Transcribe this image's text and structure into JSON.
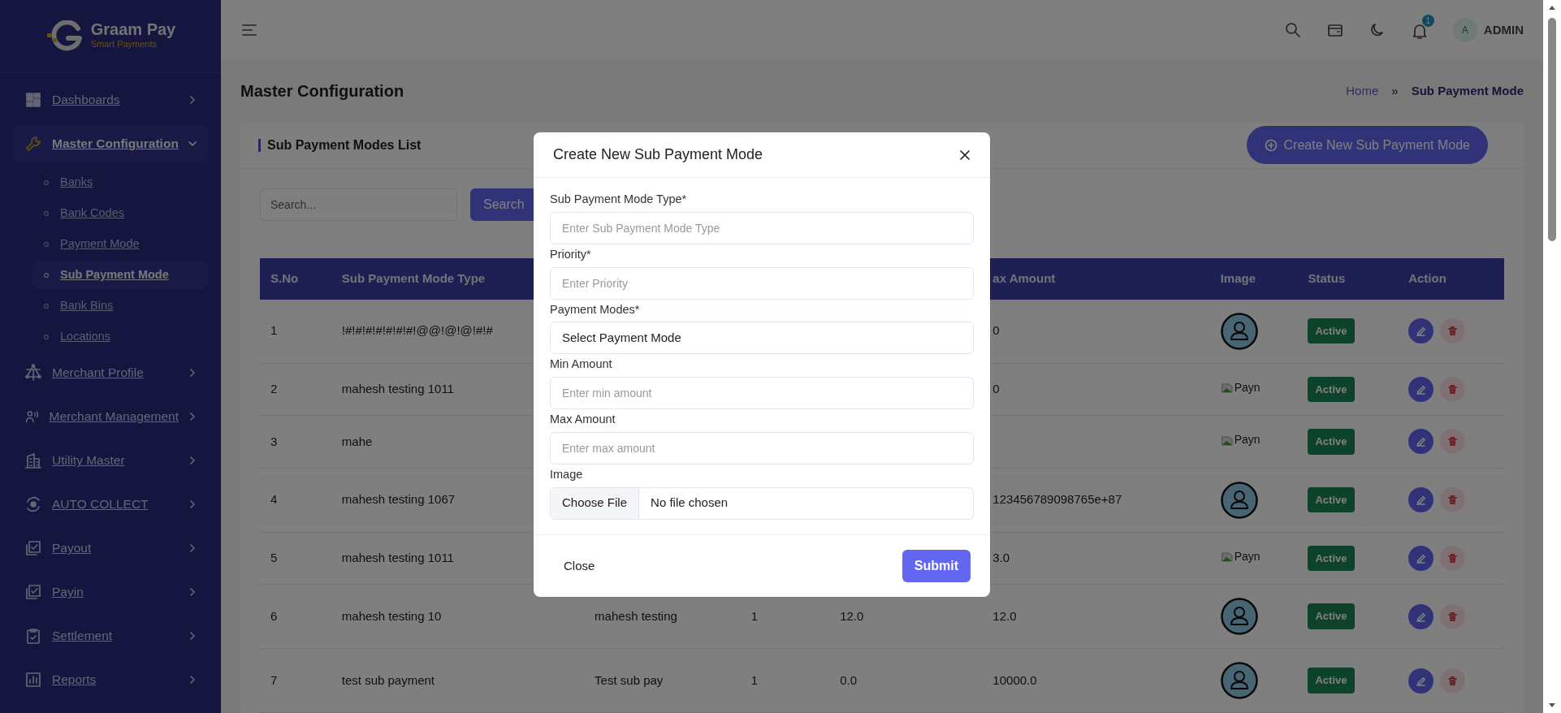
{
  "sidebar": {
    "logo": {
      "name": "Graam Pay",
      "tagline": "Smart Payments"
    },
    "items": [
      {
        "label": "Dashboards",
        "expanded": false,
        "selected": false
      },
      {
        "label": "Master Configuration",
        "expanded": true,
        "selected": true,
        "children": [
          {
            "label": "Banks",
            "selected": false
          },
          {
            "label": "Bank Codes",
            "selected": false
          },
          {
            "label": "Payment Mode",
            "selected": false
          },
          {
            "label": "Sub Payment Mode",
            "selected": true
          },
          {
            "label": "Bank Bins",
            "selected": false
          },
          {
            "label": "Locations",
            "selected": false
          }
        ]
      },
      {
        "label": "Merchant Profile",
        "expanded": false,
        "selected": false
      },
      {
        "label": "Merchant Management",
        "expanded": false,
        "selected": false
      },
      {
        "label": "Utility Master",
        "expanded": false,
        "selected": false
      },
      {
        "label": "AUTO COLLECT",
        "expanded": false,
        "selected": false
      },
      {
        "label": "Payout",
        "expanded": false,
        "selected": false
      },
      {
        "label": "Payin",
        "expanded": false,
        "selected": false
      },
      {
        "label": "Settlement",
        "expanded": false,
        "selected": false
      },
      {
        "label": "Reports",
        "expanded": false,
        "selected": false
      }
    ]
  },
  "topbar": {
    "notifications": "1",
    "user": {
      "initial": "A",
      "name": "ADMIN"
    }
  },
  "page": {
    "title": "Master Configuration",
    "breadcrumb": [
      {
        "label": "Home",
        "current": false
      },
      {
        "label": "Sub Payment Mode",
        "current": true
      }
    ],
    "separator": "»"
  },
  "card": {
    "title": "Sub Payment Modes List",
    "create_button": "Create New Sub Payment Mode",
    "search": {
      "placeholder": "Search...",
      "button": "Search"
    }
  },
  "table": {
    "columns": {
      "s_no": "S.No",
      "sub_payment_mode_type": "Sub Payment Mode Type",
      "max_amount": "ax Amount",
      "image": "Image",
      "status": "Status",
      "action": "Action"
    },
    "rows": [
      {
        "s_no": "1",
        "sub_payment_mode_type": "!#!#!#!#!#!#!#!@@!@!@!#!#",
        "max_amount": "0",
        "image": {
          "kind": "avatar"
        },
        "status": "Active"
      },
      {
        "s_no": "2",
        "sub_payment_mode_type": "mahesh testing 1011",
        "max_amount": "0",
        "image": {
          "kind": "broken",
          "alt": "Payn"
        },
        "status": "Active"
      },
      {
        "s_no": "3",
        "sub_payment_mode_type": "mahe",
        "image": {
          "kind": "broken",
          "alt": "Payn"
        },
        "status": "Active"
      },
      {
        "s_no": "4",
        "sub_payment_mode_type": "mahesh testing 1067",
        "max_amount": "123456789098765e+87",
        "image": {
          "kind": "avatar"
        },
        "status": "Active"
      },
      {
        "s_no": "5",
        "sub_payment_mode_type": "mahesh testing 1011",
        "max_amount": "3.0",
        "image": {
          "kind": "broken",
          "alt": "Payn"
        },
        "status": "Active"
      },
      {
        "s_no": "6",
        "sub_payment_mode_type": "mahesh testing 10",
        "payment_mode": "mahesh testing",
        "priority": "1",
        "min_amount": "12.0",
        "max_amount": "12.0",
        "image": {
          "kind": "avatar"
        },
        "status": "Active"
      },
      {
        "s_no": "7",
        "sub_payment_mode_type": "test sub payment",
        "payment_mode": "Test sub pay",
        "priority": "1",
        "min_amount": "0.0",
        "max_amount": "10000.0",
        "image": {
          "kind": "avatar"
        },
        "status": "Active"
      }
    ]
  },
  "modal": {
    "title": "Create New Sub Payment Mode",
    "fields": [
      {
        "label": "Sub Payment Mode Type*",
        "kind": "text",
        "placeholder": "Enter Sub Payment Mode Type"
      },
      {
        "label": "Priority*",
        "kind": "text",
        "placeholder": "Enter Priority"
      },
      {
        "label": "Payment Modes*",
        "kind": "select",
        "value": "Select Payment Mode"
      },
      {
        "label": "Min Amount",
        "kind": "text",
        "placeholder": "Enter min amount"
      },
      {
        "label": "Max Amount",
        "kind": "text",
        "placeholder": "Enter max amount"
      },
      {
        "label": "Image",
        "kind": "file",
        "button": "Choose File",
        "value": "No file chosen"
      }
    ],
    "close_button": "Close",
    "submit_button": "Submit"
  }
}
